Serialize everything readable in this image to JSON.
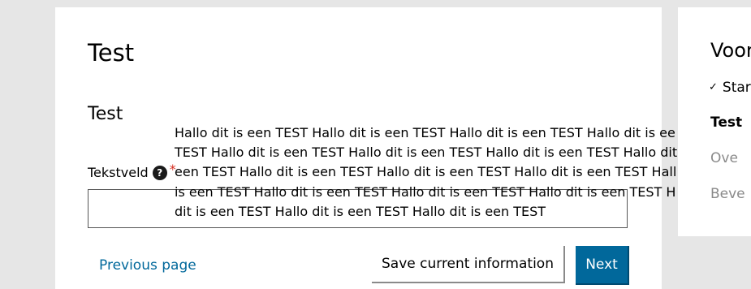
{
  "form": {
    "page_title": "Test",
    "section_title": "Test",
    "field_label": "Tekstveld",
    "help_icon": "?",
    "required_marker": "*",
    "input_value": "",
    "tooltip_lines": [
      "Hallo dit is een TEST Hallo dit is een TEST Hallo dit is een TEST Hallo dit is ee",
      "TEST Hallo dit is een TEST Hallo dit is een TEST Hallo dit is een TEST Hallo dit",
      "een TEST Hallo dit is een TEST Hallo dit is een TEST Hallo dit is een TEST Hall",
      "is een TEST Hallo dit is een TEST Hallo dit is een TEST Hallo dit is een TEST H",
      "dit is een TEST Hallo dit is een TEST Hallo dit is een TEST"
    ]
  },
  "navigation": {
    "previous_label": "Previous page",
    "save_label": "Save current information",
    "next_label": "Next"
  },
  "progress": {
    "title": "Voor",
    "check_icon": "✓",
    "steps": [
      {
        "label": "Star",
        "state": "done"
      },
      {
        "label": "Test",
        "state": "current"
      },
      {
        "label": "Ove",
        "state": "future"
      },
      {
        "label": "Beve",
        "state": "future"
      }
    ]
  },
  "colors": {
    "background": "#e6e6e6",
    "primary": "#01689b",
    "link": "#01689b",
    "required": "#d52b1e",
    "muted": "#8a8a8a"
  }
}
